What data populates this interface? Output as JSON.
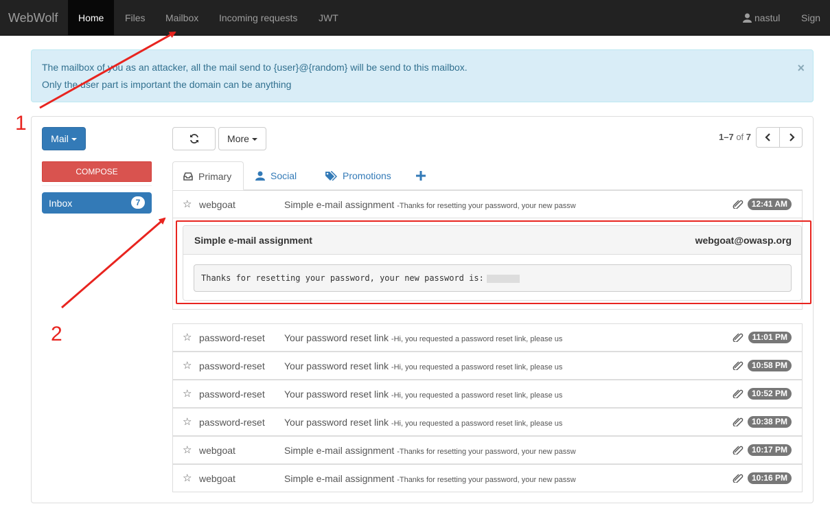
{
  "navbar": {
    "brand": "WebWolf",
    "items": [
      "Home",
      "Files",
      "Mailbox",
      "Incoming requests",
      "JWT"
    ],
    "user": "nastul",
    "signout": "Sign ou"
  },
  "alert": {
    "line1": "The mailbox of you as an attacker, all the mail send to {user}@{random} will be send to this mailbox.",
    "line2": "Only the user part is important the domain can be anything",
    "close": "×"
  },
  "sidebar": {
    "mail_button": "Mail",
    "compose_button": "COMPOSE",
    "inbox_label": "Inbox",
    "inbox_count": "7"
  },
  "toolbar": {
    "more_button": "More",
    "pager_range": "1–7",
    "pager_of": "of",
    "pager_total": "7"
  },
  "tabs": [
    "Primary",
    "Social",
    "Promotions"
  ],
  "mails": [
    {
      "sender": "webgoat",
      "subject": "Simple e-mail assignment",
      "preview": "-Thanks for resetting your password, your new passw",
      "time": "12:41 AM"
    },
    {
      "sender": "password-reset",
      "subject": "Your password reset link",
      "preview": "-Hi, you requested a password reset link, please us",
      "time": "11:01 PM"
    },
    {
      "sender": "password-reset",
      "subject": "Your password reset link",
      "preview": "-Hi, you requested a password reset link, please us",
      "time": "10:58 PM"
    },
    {
      "sender": "password-reset",
      "subject": "Your password reset link",
      "preview": "-Hi, you requested a password reset link, please us",
      "time": "10:52 PM"
    },
    {
      "sender": "password-reset",
      "subject": "Your password reset link",
      "preview": "-Hi, you requested a password reset link, please us",
      "time": "10:38 PM"
    },
    {
      "sender": "webgoat",
      "subject": "Simple e-mail assignment",
      "preview": "-Thanks for resetting your password, your new passw",
      "time": "10:17 PM"
    },
    {
      "sender": "webgoat",
      "subject": "Simple e-mail assignment",
      "preview": "-Thanks for resetting your password, your new passw",
      "time": "10:16 PM"
    }
  ],
  "opened_mail": {
    "title": "Simple e-mail assignment",
    "from": "webgoat@owasp.org",
    "body": "Thanks for resetting your password, your new password is:"
  },
  "annotations": {
    "one": "1",
    "two": "2"
  },
  "colors": {
    "navbar": "#222222",
    "primary": "#337ab7",
    "danger": "#d9534f",
    "alert_bg": "#d9edf7",
    "annotation": "#e8241f"
  }
}
